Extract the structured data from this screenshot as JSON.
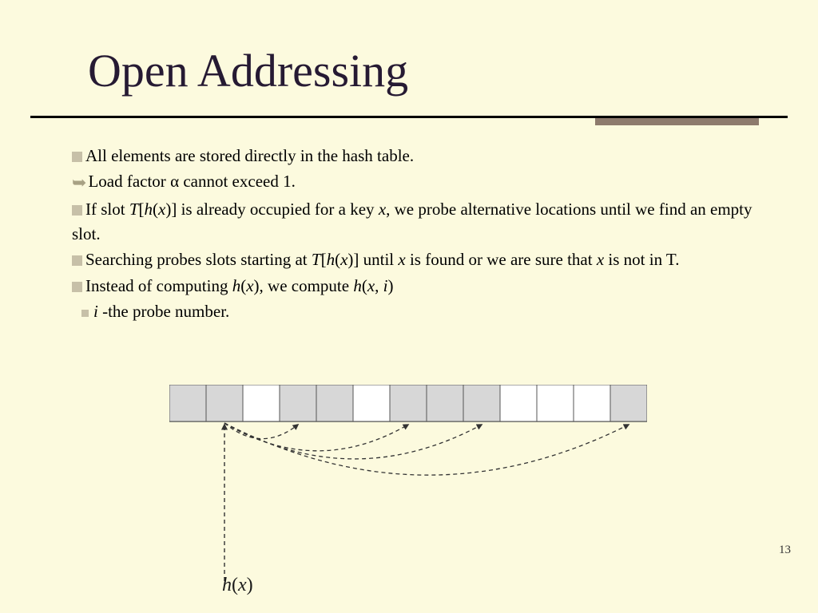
{
  "title": "Open Addressing",
  "bullets": {
    "b1": "All elements are stored directly in the hash table.",
    "b2_pre": "Load factor ",
    "b2_alpha": "α",
    "b2_post": " cannot exceed 1.",
    "b3": "If slot T[h(x)] is already occupied for a key x, we probe alternative locations until we find an empty slot.",
    "b4": "Searching probes slots starting at T[h(x)] until x is found or we are sure that x is not in T.",
    "b5": "Instead of computing h(x), we compute h(x, i)",
    "b6_i": "i",
    "b6_rest": " -the probe number."
  },
  "figure": {
    "hx_label": "h(x)",
    "slots": 13,
    "occupied_indices": [
      0,
      1,
      3,
      4,
      6,
      7,
      8,
      12
    ],
    "hash_slot": 1,
    "probe_to": [
      3,
      6,
      8,
      12
    ]
  },
  "page_number": "13"
}
